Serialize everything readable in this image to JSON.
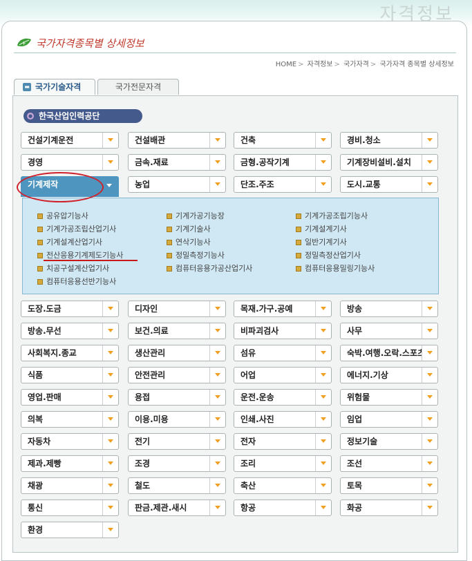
{
  "watermark": "자격정보",
  "page_title": "국가자격종목별 상세정보",
  "breadcrumb": [
    "HOME",
    "자격정보",
    "국가자격",
    "국가자격 종목별 상세정보"
  ],
  "breadcrumb_sep": ">",
  "tabs": [
    {
      "label": "국가기술자격",
      "active": true
    },
    {
      "label": "국가전문자격",
      "active": false
    }
  ],
  "organization": "한국산업인력공단",
  "categories_top": [
    "건설기계운전",
    "건설배관",
    "건축",
    "경비.청소",
    "경영",
    "금속.재료",
    "금형.공작기계",
    "기계장비설비.설치",
    "기계제작",
    "농업",
    "단조.주조",
    "도시.교통"
  ],
  "active_category": "기계제작",
  "sub_items": [
    [
      "공유압기능사",
      "기계가공기능장",
      "기계가공조립기능사"
    ],
    [
      "기계가공조립산업기사",
      "기계기술사",
      "기계설계기사"
    ],
    [
      "기계설계산업기사",
      "연삭기능사",
      "일반기계기사"
    ],
    [
      "전산응용기계제도기능사",
      "정밀측정기능사",
      "정밀측정산업기사"
    ],
    [
      "치공구설계산업기사",
      "컴퓨터응용가공산업기사",
      "컴퓨터응용밀링기능사"
    ],
    [
      "컴퓨터응용선반기능사"
    ]
  ],
  "highlighted_sub": "전산응용기계제도기능사",
  "categories_bottom": [
    "도장.도금",
    "디자인",
    "목재.가구.공예",
    "방송",
    "방송.무선",
    "보건.의료",
    "비파괴검사",
    "사무",
    "사회복지.종교",
    "생산관리",
    "섬유",
    "숙박.여행.오락.스포츠",
    "식품",
    "안전관리",
    "어업",
    "에너지.기상",
    "영업.판매",
    "용접",
    "운전.운송",
    "위험물",
    "의복",
    "이용.미용",
    "인쇄.사진",
    "임업",
    "자동차",
    "전기",
    "전자",
    "정보기술",
    "제과.제빵",
    "조경",
    "조리",
    "조선",
    "채광",
    "철도",
    "축산",
    "토목",
    "통신",
    "판금.제관.새시",
    "항공",
    "화공",
    "환경"
  ],
  "colors": {
    "accent": "#4e96bf",
    "highlight_red": "#d0202a",
    "arrow": "#f0a020",
    "org_pill": "#455a8c",
    "expand_bg": "#cfe8f4"
  }
}
